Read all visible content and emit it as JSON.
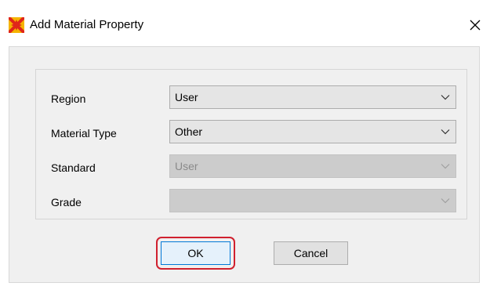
{
  "window": {
    "title": "Add Material Property",
    "app_icon": "etabs-x-icon",
    "close_glyph": "✕"
  },
  "form": {
    "rows": [
      {
        "label": "Region",
        "value": "User",
        "enabled": true
      },
      {
        "label": "Material Type",
        "value": "Other",
        "enabled": true
      },
      {
        "label": "Standard",
        "value": "User",
        "enabled": false
      },
      {
        "label": "Grade",
        "value": "",
        "enabled": false
      }
    ]
  },
  "buttons": {
    "ok_label": "OK",
    "cancel_label": "Cancel"
  },
  "colors": {
    "highlight": "#d0202e",
    "default_button_border": "#0078d7"
  }
}
